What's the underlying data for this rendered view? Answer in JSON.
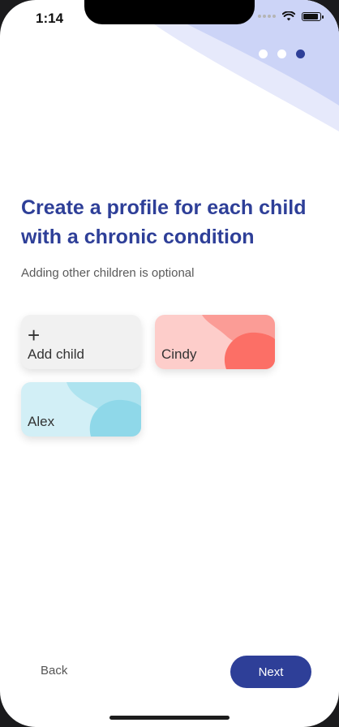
{
  "status_bar": {
    "time": "1:14"
  },
  "pager": {
    "total": 3,
    "active_index": 2
  },
  "heading": {
    "title": "Create a profile for each child with a chronic condition",
    "subtitle": "Adding other children is optional"
  },
  "children": {
    "add_label": "Add child",
    "add_icon": "+",
    "items": [
      {
        "name": "Cindy"
      },
      {
        "name": "Alex"
      }
    ]
  },
  "footer": {
    "back_label": "Back",
    "next_label": "Next"
  },
  "colors": {
    "accent": "#2e3f98",
    "cindy_card": "#fdcdca",
    "alex_card": "#d2eff6",
    "add_card": "#f1f1f1"
  }
}
